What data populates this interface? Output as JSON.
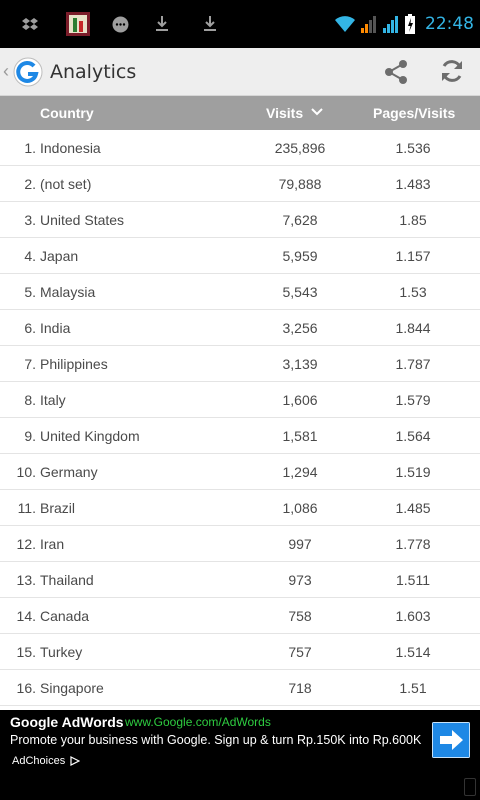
{
  "status_bar": {
    "time": "22:48",
    "left_icons": [
      "dropbox-icon",
      "app-notification-icon",
      "chat-bubble-icon",
      "download-icon",
      "download-icon"
    ],
    "right_icons": [
      "wifi-icon",
      "signal-icon",
      "signal-icon",
      "battery-icon"
    ]
  },
  "action_bar": {
    "title": "Analytics",
    "up_glyph": "‹",
    "actions": [
      "share-icon",
      "refresh-icon"
    ]
  },
  "table": {
    "columns": {
      "country": "Country",
      "visits": "Visits",
      "pages_per_visit": "Pages/Visits"
    },
    "sorted_by": "visits",
    "rows": [
      {
        "rank": "1.",
        "country": "Indonesia",
        "visits": "235,896",
        "pages": "1.536"
      },
      {
        "rank": "2.",
        "country": "(not set)",
        "visits": "79,888",
        "pages": "1.483"
      },
      {
        "rank": "3.",
        "country": "United States",
        "visits": "7,628",
        "pages": "1.85"
      },
      {
        "rank": "4.",
        "country": "Japan",
        "visits": "5,959",
        "pages": "1.157"
      },
      {
        "rank": "5.",
        "country": "Malaysia",
        "visits": "5,543",
        "pages": "1.53"
      },
      {
        "rank": "6.",
        "country": "India",
        "visits": "3,256",
        "pages": "1.844"
      },
      {
        "rank": "7.",
        "country": "Philippines",
        "visits": "3,139",
        "pages": "1.787"
      },
      {
        "rank": "8.",
        "country": "Italy",
        "visits": "1,606",
        "pages": "1.579"
      },
      {
        "rank": "9.",
        "country": "United Kingdom",
        "visits": "1,581",
        "pages": "1.564"
      },
      {
        "rank": "10.",
        "country": "Germany",
        "visits": "1,294",
        "pages": "1.519"
      },
      {
        "rank": "11.",
        "country": "Brazil",
        "visits": "1,086",
        "pages": "1.485"
      },
      {
        "rank": "12.",
        "country": "Iran",
        "visits": "997",
        "pages": "1.778"
      },
      {
        "rank": "13.",
        "country": "Thailand",
        "visits": "973",
        "pages": "1.511"
      },
      {
        "rank": "14.",
        "country": "Canada",
        "visits": "758",
        "pages": "1.603"
      },
      {
        "rank": "15.",
        "country": "Turkey",
        "visits": "757",
        "pages": "1.514"
      },
      {
        "rank": "16.",
        "country": "Singapore",
        "visits": "718",
        "pages": "1.51"
      }
    ]
  },
  "ad": {
    "title": "Google AdWords",
    "url": "www.Google.com/AdWords",
    "text": "Promote your business with Google. Sign up & turn Rp.150K into Rp.600K",
    "choices_label": "AdChoices"
  },
  "colors": {
    "accent_blue": "#33b5e5",
    "header_gray": "#9f9f9f",
    "ad_url_green": "#2ecc40",
    "ad_button_blue": "#1e88e5"
  }
}
